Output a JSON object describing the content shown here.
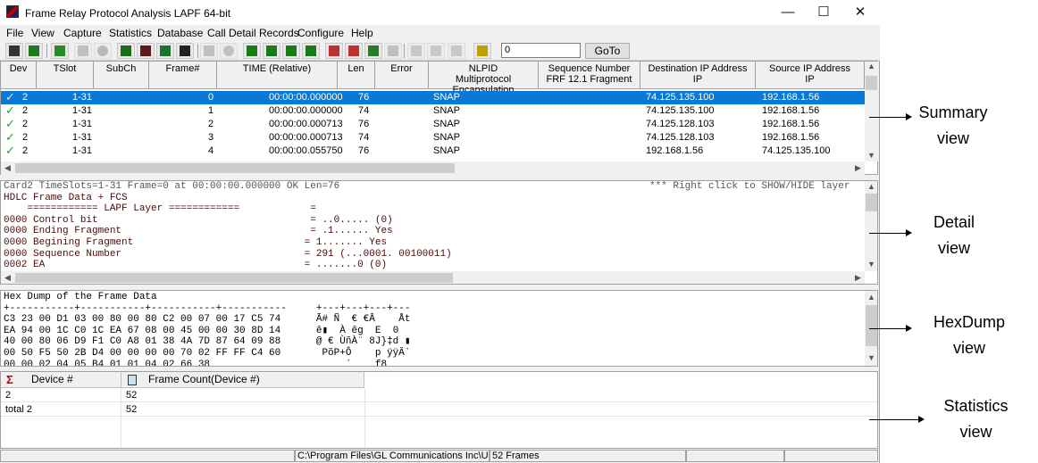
{
  "window": {
    "title": "Frame Relay Protocol Analysis LAPF 64-bit",
    "min": "—",
    "max": "☐",
    "close": "✕"
  },
  "menu": [
    "File",
    "View",
    "Capture",
    "Statistics",
    "Database",
    "Call Detail Records",
    "Configure",
    "Help"
  ],
  "toolbar": {
    "frame_value": "0",
    "goto_label": "GoTo"
  },
  "summary": {
    "columns": [
      "Dev",
      "TSlot",
      "SubCh",
      "Frame#",
      "TIME (Relative)",
      "Len",
      "Error",
      "NLPID\nMultiprotocol Encapsulation",
      "Sequence Number\nFRF 12.1 Fragment",
      "Destination IP Address\nIP",
      "Source IP Address\nIP"
    ],
    "rows": [
      {
        "dev": "2",
        "tslot": "1-31",
        "frame": "0",
        "time": "00:00:00.000000",
        "len": "76",
        "nlpid": "SNAP",
        "dst": "74.125.135.100",
        "src": "192.168.1.56",
        "selected": true
      },
      {
        "dev": "2",
        "tslot": "1-31",
        "frame": "1",
        "time": "00:00:00.000000",
        "len": "74",
        "nlpid": "SNAP",
        "dst": "74.125.135.100",
        "src": "192.168.1.56",
        "selected": false
      },
      {
        "dev": "2",
        "tslot": "1-31",
        "frame": "2",
        "time": "00:00:00.000713",
        "len": "76",
        "nlpid": "SNAP",
        "dst": "74.125.128.103",
        "src": "192.168.1.56",
        "selected": false
      },
      {
        "dev": "2",
        "tslot": "1-31",
        "frame": "3",
        "time": "00:00:00.000713",
        "len": "74",
        "nlpid": "SNAP",
        "dst": "74.125.128.103",
        "src": "192.168.1.56",
        "selected": false
      },
      {
        "dev": "2",
        "tslot": "1-31",
        "frame": "4",
        "time": "00:00:00.055750",
        "len": "76",
        "nlpid": "SNAP",
        "dst": "192.168.1.56",
        "src": "74.125.135.100",
        "selected": false
      }
    ]
  },
  "detail": {
    "header_left": "Card2 TimeSlots=1-31 Frame=0 at 00:00:00.000000 OK Len=76",
    "header_right": "*** Right click to SHOW/HIDE layer",
    "lines": [
      "HDLC Frame Data + FCS",
      "    ============ LAPF Layer ============            =",
      "0000 Control bit                                    = ..0..... (0)",
      "0000 Ending Fragment                                = .1...... Yes",
      "0000 Begining Fragment                             = 1....... Yes",
      "0000 Sequence Number                               = 291 (...0001. 00100011)",
      "0002 EA                                            = .......0 (0)"
    ]
  },
  "hexdump": {
    "lines": [
      "Hex Dump of the Frame Data",
      "+-----------+-----------+-----------+-----------     +---+---+---+---",
      "C3 23 00 D1 03 00 80 00 80 C2 00 07 00 17 C5 74      Ã# Ñ  € €Â    Åt",
      "EA 94 00 1C C0 1C EA 67 08 00 45 00 00 30 8D 14      ê▮  À êg  E  0",
      "40 00 80 06 D9 F1 C0 A8 01 38 4A 7D 87 64 09 88      @ € ÙñÀ¨ 8J}‡d ▮",
      "00 50 F5 50 2B D4 00 00 00 00 70 02 FF FF C4 60       PõP+Ô    p ÿÿÄ`",
      "00 00 02 04 05 B4 01 01 04 02 66 38                       ´    f8"
    ]
  },
  "statistics": {
    "columns": [
      "Device #",
      "Frame Count(Device #)"
    ],
    "rows": [
      {
        "device": "2",
        "count": "52"
      },
      {
        "device": "total 2",
        "count": "52"
      }
    ]
  },
  "statusbar": {
    "path": "C:\\Program Files\\GL Communications Inc\\U:",
    "frames": "52 Frames"
  },
  "annotations": {
    "summary": "Summary\nview",
    "detail": "Detail\nview",
    "hexdump": "HexDump\nview",
    "statistics": "Statistics\nview"
  }
}
